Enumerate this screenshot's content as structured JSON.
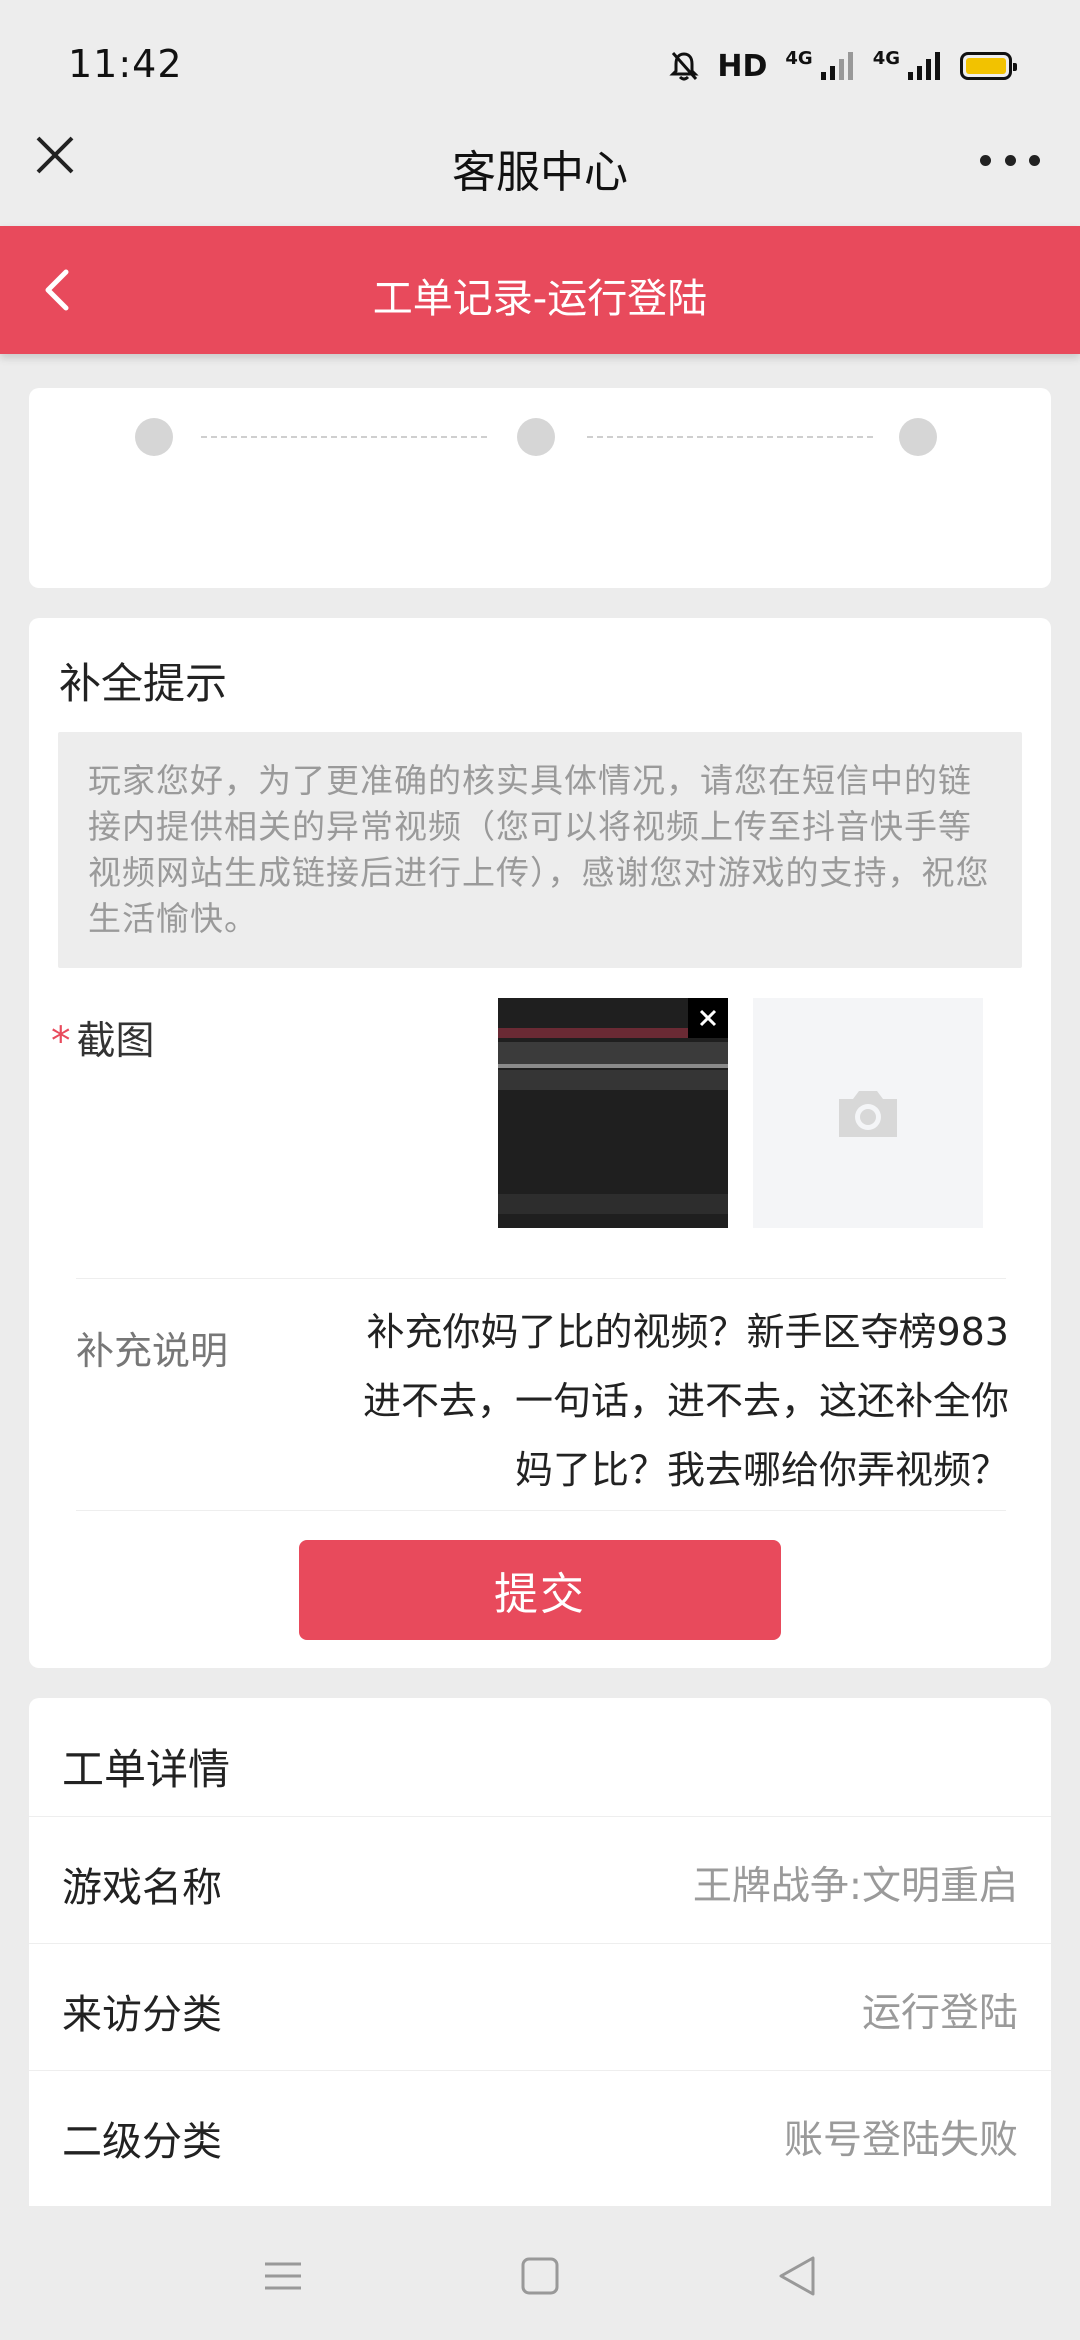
{
  "status_bar": {
    "time": "11:42",
    "hd_label": "HD",
    "network_1": "4G",
    "network_2": "4G",
    "icons": [
      "mute-bell-icon",
      "signal-icon",
      "signal-icon",
      "battery-icon"
    ]
  },
  "title_bar": {
    "title": "客服中心",
    "close_icon": "close-icon",
    "more_icon": "more-icon"
  },
  "sub_header": {
    "title": "工单记录-运行登陆",
    "back_icon": "chevron-left-icon",
    "color": "#e84a5c"
  },
  "supplement": {
    "title": "补全提示",
    "notice": "玩家您好，为了更准确的核实具体情况，请您在短信中的链接内提供相关的异常视频（您可以将视频上传至抖音快手等视频网站生成链接后进行上传），感谢您对游戏的支持，祝您生活愉快。",
    "screenshot_required": "*",
    "screenshot_label": "截图",
    "upload_icon": "camera-icon",
    "description_label": "补充说明",
    "description_value": "补充你妈了比的视频？新手区夺榜983进不去，一句话，进不去，这还补全你妈了比？我去哪给你弄视频？",
    "submit_label": "提交"
  },
  "detail": {
    "title": "工单详情",
    "rows": [
      {
        "label": "游戏名称",
        "value": "王牌战争:文明重启"
      },
      {
        "label": "来访分类",
        "value": "运行登陆"
      },
      {
        "label": "二级分类",
        "value": "账号登陆失败"
      }
    ]
  },
  "nav_bar": {
    "icons": [
      "menu-icon",
      "home-icon",
      "back-icon"
    ]
  }
}
